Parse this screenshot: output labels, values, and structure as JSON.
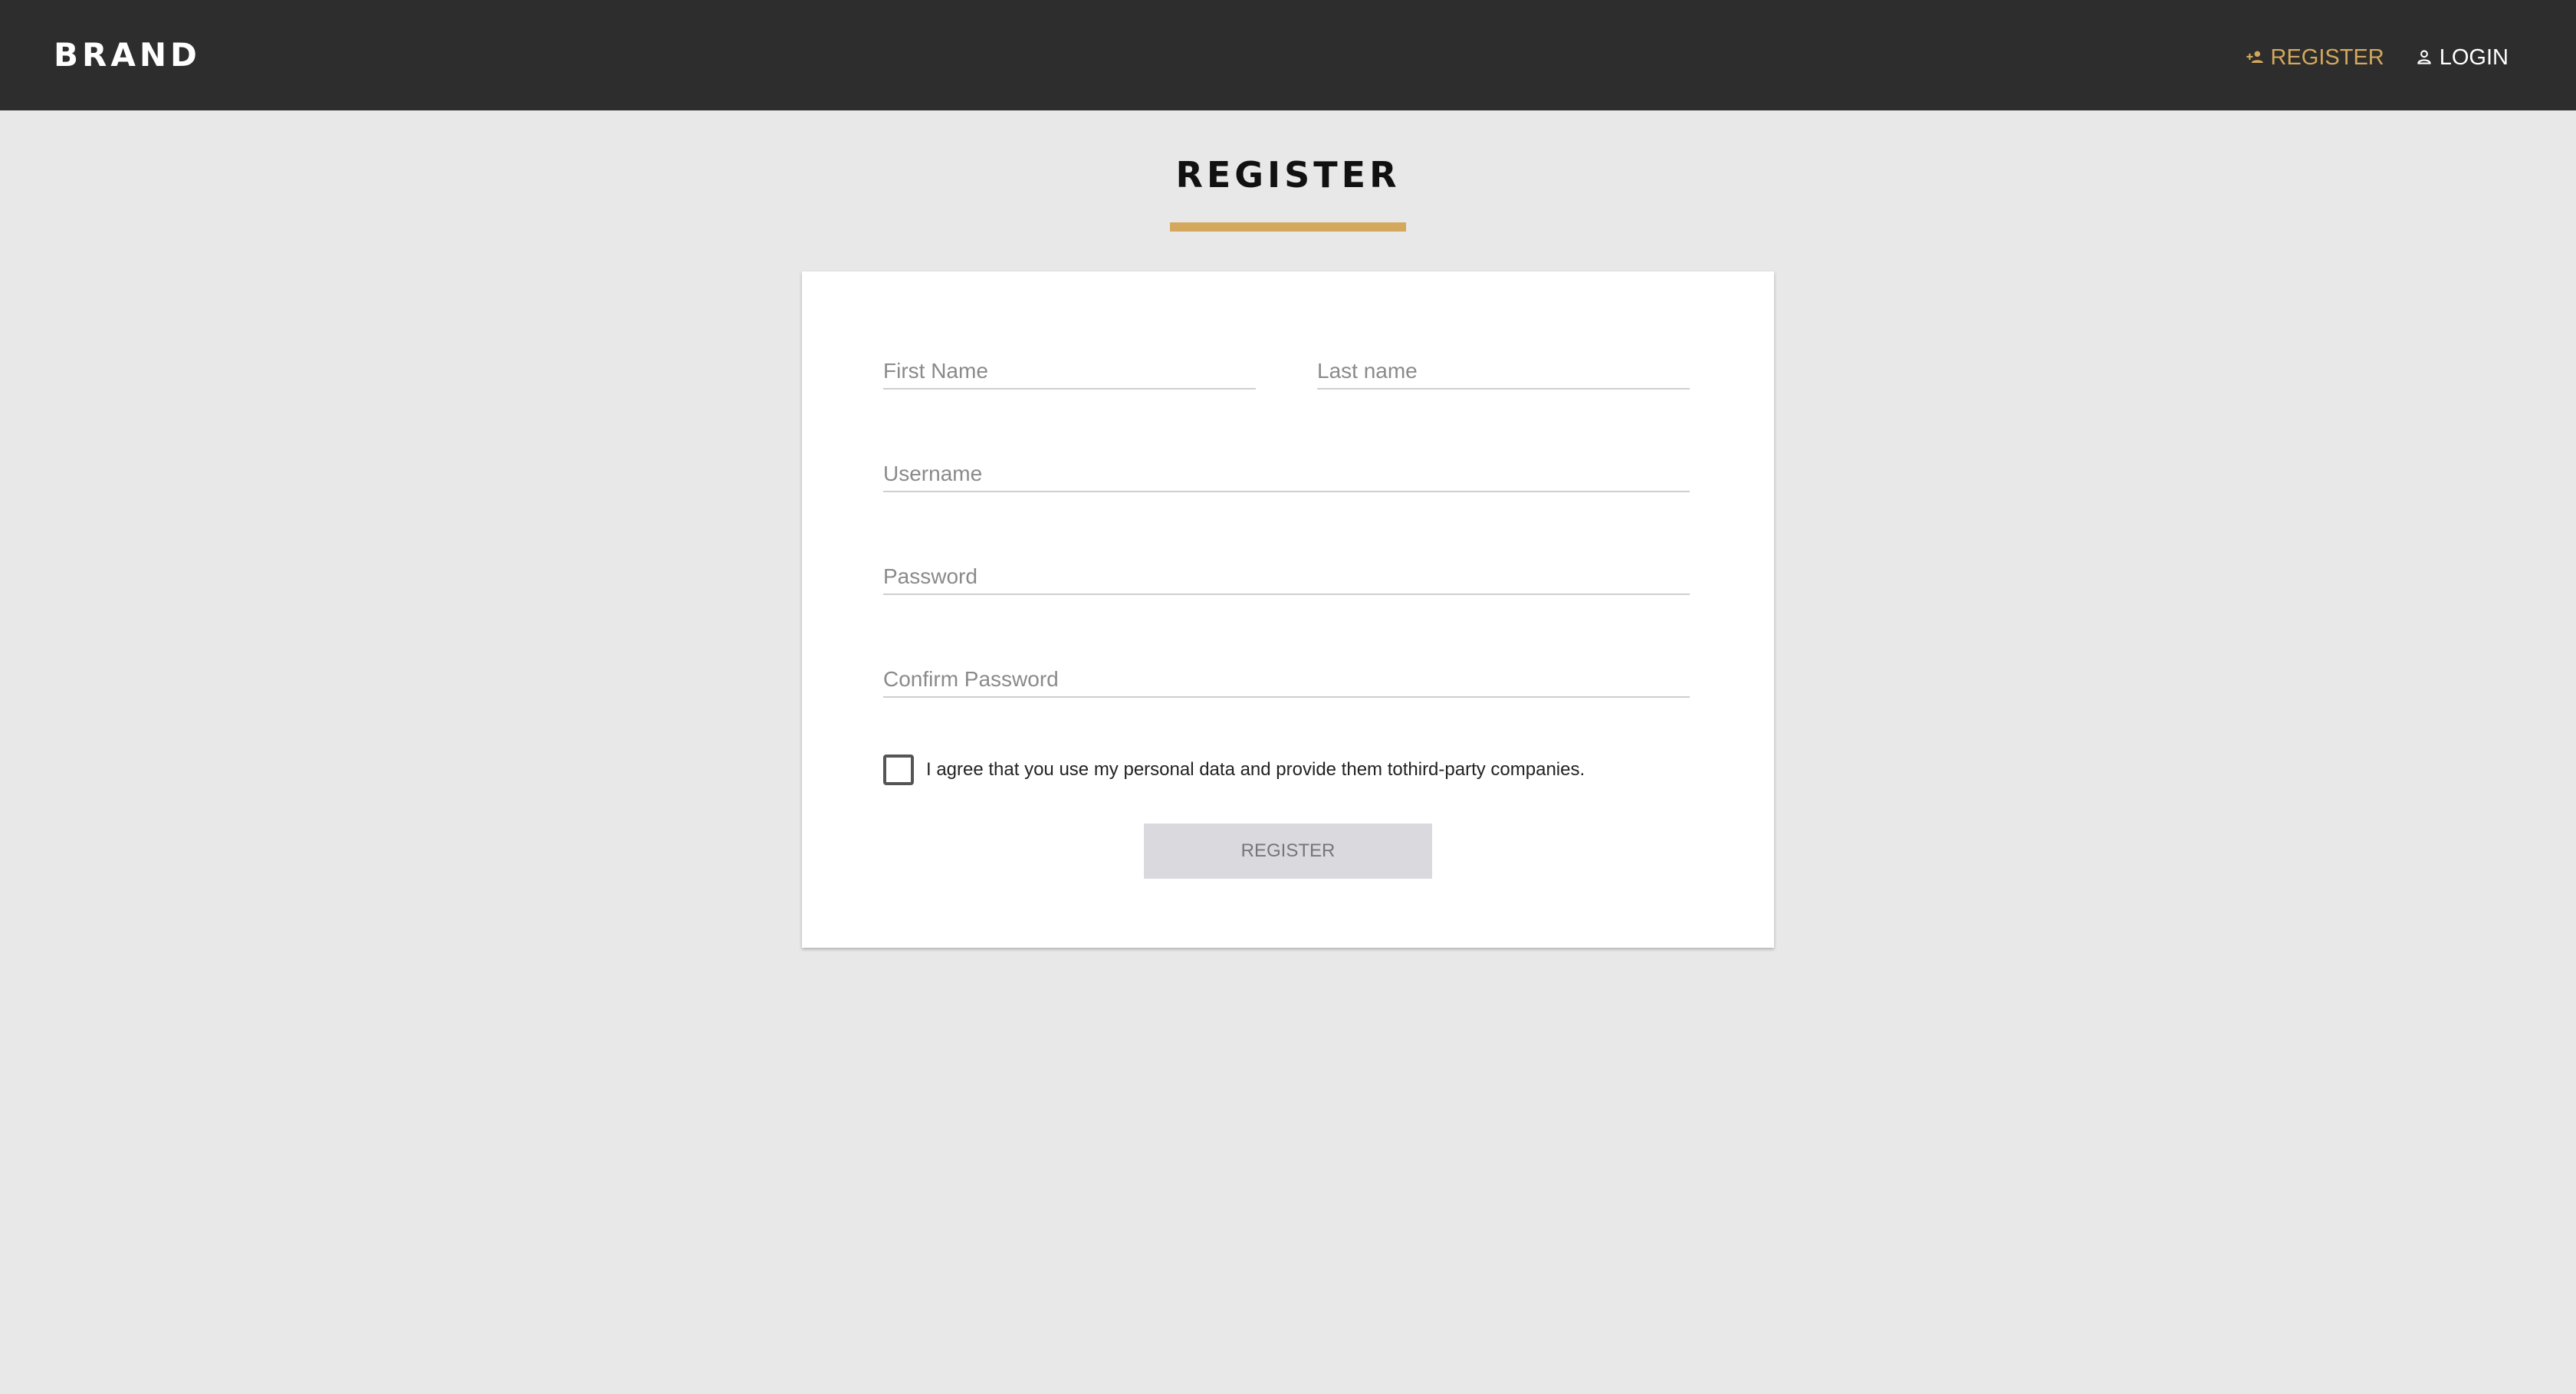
{
  "navbar": {
    "brand": "BRAND",
    "register_label": "REGISTER",
    "login_label": "LOGIN"
  },
  "page": {
    "title": "REGISTER"
  },
  "form": {
    "first_name_placeholder": "First Name",
    "last_name_placeholder": "Last name",
    "username_placeholder": "Username",
    "password_placeholder": "Password",
    "confirm_password_placeholder": "Confirm Password",
    "agree_label": "I agree that you use my personal data and provide them tothird-party companies.",
    "agree_checked": false,
    "submit_label": "REGISTER"
  },
  "colors": {
    "navbar_bg": "#2d2d2d",
    "accent": "#d4a85c",
    "page_bg": "#e8e8e8",
    "button_disabled_bg": "#d9d9de"
  }
}
